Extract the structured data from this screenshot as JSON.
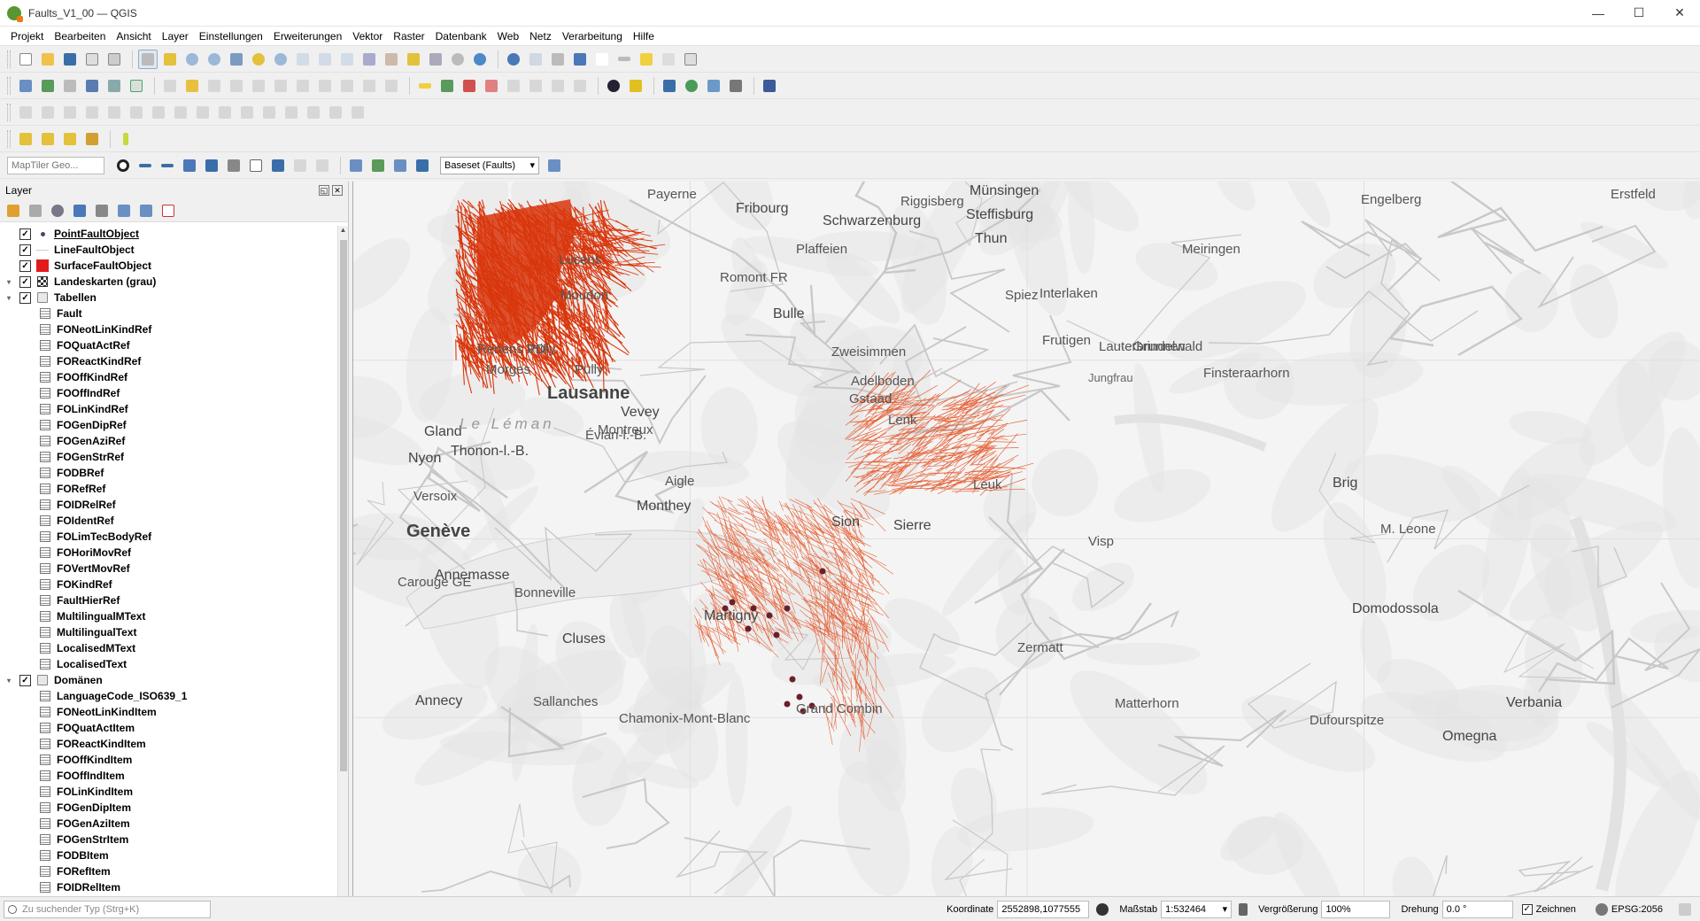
{
  "window": {
    "title": "Faults_V1_00 — QGIS",
    "minimize": "—",
    "maximize": "☐",
    "close": "✕"
  },
  "menu": [
    "Projekt",
    "Bearbeiten",
    "Ansicht",
    "Layer",
    "Einstellungen",
    "Erweiterungen",
    "Vektor",
    "Raster",
    "Datenbank",
    "Web",
    "Netz",
    "Verarbeitung",
    "Hilfe"
  ],
  "toolbar": {
    "maptiler_placeholder": "MapTiler Geo...",
    "baseset_combo": "Baseset (Faults)"
  },
  "layers_panel": {
    "title": "Layer",
    "layers": [
      {
        "label": "PointFaultObject",
        "kind": "point",
        "checked": true,
        "level": 0,
        "selected": true
      },
      {
        "label": "LineFaultObject",
        "kind": "line",
        "checked": true,
        "level": 0
      },
      {
        "label": "SurfaceFaultObject",
        "kind": "polygon",
        "checked": true,
        "level": 0
      },
      {
        "label": "Landeskarten (grau)",
        "kind": "raster",
        "checked": true,
        "level": 0,
        "expander": "▾"
      },
      {
        "label": "Tabellen",
        "kind": "group",
        "checked": true,
        "level": 0,
        "expander": "▾"
      },
      {
        "label": "Fault",
        "kind": "table",
        "level": 1
      },
      {
        "label": "FONeotLinKindRef",
        "kind": "table",
        "level": 1
      },
      {
        "label": "FOQuatActRef",
        "kind": "table",
        "level": 1
      },
      {
        "label": "FOReactKindRef",
        "kind": "table",
        "level": 1
      },
      {
        "label": "FOOffKindRef",
        "kind": "table",
        "level": 1
      },
      {
        "label": "FOOffIndRef",
        "kind": "table",
        "level": 1
      },
      {
        "label": "FOLinKindRef",
        "kind": "table",
        "level": 1
      },
      {
        "label": "FOGenDipRef",
        "kind": "table",
        "level": 1
      },
      {
        "label": "FOGenAziRef",
        "kind": "table",
        "level": 1
      },
      {
        "label": "FOGenStrRef",
        "kind": "table",
        "level": 1
      },
      {
        "label": "FODBRef",
        "kind": "table",
        "level": 1
      },
      {
        "label": "FORefRef",
        "kind": "table",
        "level": 1
      },
      {
        "label": "FOIDRelRef",
        "kind": "table",
        "level": 1
      },
      {
        "label": "FOIdentRef",
        "kind": "table",
        "level": 1
      },
      {
        "label": "FOLimTecBodyRef",
        "kind": "table",
        "level": 1
      },
      {
        "label": "FOHoriMovRef",
        "kind": "table",
        "level": 1
      },
      {
        "label": "FOVertMovRef",
        "kind": "table",
        "level": 1
      },
      {
        "label": "FOKindRef",
        "kind": "table",
        "level": 1
      },
      {
        "label": "FaultHierRef",
        "kind": "table",
        "level": 1
      },
      {
        "label": "MultilingualMText",
        "kind": "table",
        "level": 1
      },
      {
        "label": "MultilingualText",
        "kind": "table",
        "level": 1
      },
      {
        "label": "LocalisedMText",
        "kind": "table",
        "level": 1
      },
      {
        "label": "LocalisedText",
        "kind": "table",
        "level": 1
      },
      {
        "label": "Domänen",
        "kind": "group",
        "checked": true,
        "level": 0,
        "expander": "▾"
      },
      {
        "label": "LanguageCode_ISO639_1",
        "kind": "table",
        "level": 1
      },
      {
        "label": "FONeotLinKindItem",
        "kind": "table",
        "level": 1
      },
      {
        "label": "FOQuatActItem",
        "kind": "table",
        "level": 1
      },
      {
        "label": "FOReactKindItem",
        "kind": "table",
        "level": 1
      },
      {
        "label": "FOOffKindItem",
        "kind": "table",
        "level": 1
      },
      {
        "label": "FOOffIndItem",
        "kind": "table",
        "level": 1
      },
      {
        "label": "FOLinKindItem",
        "kind": "table",
        "level": 1
      },
      {
        "label": "FOGenDipItem",
        "kind": "table",
        "level": 1
      },
      {
        "label": "FOGenAziItem",
        "kind": "table",
        "level": 1
      },
      {
        "label": "FOGenStrItem",
        "kind": "table",
        "level": 1
      },
      {
        "label": "FODBItem",
        "kind": "table",
        "level": 1
      },
      {
        "label": "FORefItem",
        "kind": "table",
        "level": 1
      },
      {
        "label": "FOIDRelItem",
        "kind": "table",
        "level": 1
      }
    ]
  },
  "map": {
    "places": [
      {
        "t": "Fribourg",
        "c": "mid"
      },
      {
        "t": "Schwarzenburg",
        "c": "mid"
      },
      {
        "t": "Riggisberg",
        "c": ""
      },
      {
        "t": "Münsingen",
        "c": "mid"
      },
      {
        "t": "Steffisburg",
        "c": "mid"
      },
      {
        "t": "Thun",
        "c": "mid"
      },
      {
        "t": "Engelberg",
        "c": ""
      },
      {
        "t": "Erstfeld",
        "c": ""
      },
      {
        "t": "Payerne",
        "c": ""
      },
      {
        "t": "Romont FR",
        "c": ""
      },
      {
        "t": "Plaffeien",
        "c": ""
      },
      {
        "t": "Lucens",
        "c": ""
      },
      {
        "t": "Moudon",
        "c": ""
      },
      {
        "t": "Bulle",
        "c": "mid"
      },
      {
        "t": "Spiez",
        "c": ""
      },
      {
        "t": "Interlaken",
        "c": ""
      },
      {
        "t": "Meiringen",
        "c": ""
      },
      {
        "t": "Frutigen",
        "c": ""
      },
      {
        "t": "Lausanne",
        "c": "big"
      },
      {
        "t": "Renens VD",
        "c": ""
      },
      {
        "t": "Prilly",
        "c": ""
      },
      {
        "t": "Pully",
        "c": ""
      },
      {
        "t": "Morges",
        "c": ""
      },
      {
        "t": "Vevey",
        "c": "mid"
      },
      {
        "t": "Montreux",
        "c": ""
      },
      {
        "t": "Zweisimmen",
        "c": ""
      },
      {
        "t": "Adelboden",
        "c": ""
      },
      {
        "t": "Gstaad",
        "c": ""
      },
      {
        "t": "Lenk",
        "c": ""
      },
      {
        "t": "Lauterbrunnen",
        "c": ""
      },
      {
        "t": "Grindelwald",
        "c": ""
      },
      {
        "t": "Jungfrau",
        "c": "small"
      },
      {
        "t": "Finsteraarhorn",
        "c": ""
      },
      {
        "t": "Gland",
        "c": "mid"
      },
      {
        "t": "Nyon",
        "c": "mid"
      },
      {
        "t": "Thonon-l.-B.",
        "c": "mid"
      },
      {
        "t": "Évian-l.-B.",
        "c": ""
      },
      {
        "t": "Aigle",
        "c": ""
      },
      {
        "t": "Leuk",
        "c": ""
      },
      {
        "t": "Brig",
        "c": "mid"
      },
      {
        "t": "Genève",
        "c": "big"
      },
      {
        "t": "Versoix",
        "c": ""
      },
      {
        "t": "Annemasse",
        "c": "mid"
      },
      {
        "t": "Monthey",
        "c": "mid"
      },
      {
        "t": "Sion",
        "c": "mid"
      },
      {
        "t": "Sierre",
        "c": "mid"
      },
      {
        "t": "Visp",
        "c": ""
      },
      {
        "t": "Carouge GE",
        "c": ""
      },
      {
        "t": "Bonneville",
        "c": ""
      },
      {
        "t": "Cluses",
        "c": "mid"
      },
      {
        "t": "Martigny",
        "c": "mid"
      },
      {
        "t": "Zermatt",
        "c": ""
      },
      {
        "t": "Domodossola",
        "c": "mid"
      },
      {
        "t": "Annecy",
        "c": "mid"
      },
      {
        "t": "Sallanches",
        "c": ""
      },
      {
        "t": "Grand Combin",
        "c": ""
      },
      {
        "t": "Matterhorn",
        "c": ""
      },
      {
        "t": "Dufourspitze",
        "c": ""
      },
      {
        "t": "Verbania",
        "c": "mid"
      },
      {
        "t": "Omegna",
        "c": "mid"
      },
      {
        "t": "Chamonix-Mont-Blanc",
        "c": ""
      },
      {
        "t": "M. Leone",
        "c": ""
      },
      {
        "t": "Le Léman",
        "c": "water"
      }
    ]
  },
  "status": {
    "locator_placeholder": "Zu suchender Typ (Strg+K)",
    "coord_label": "Koordinate",
    "coord_value": "2552898,1077555",
    "scale_label": "Maßstab",
    "scale_value": "1:532464",
    "magnifier_label": "Vergrößerung",
    "magnifier_value": "100%",
    "rotation_label": "Drehung",
    "rotation_value": "0.0 °",
    "render_label": "Zeichnen",
    "crs": "EPSG:2056"
  },
  "colors": {
    "fault": "#d9360c",
    "fault_light": "#e6643a",
    "point": "#6b1f2a",
    "map_bg": "#f4f4f4"
  }
}
